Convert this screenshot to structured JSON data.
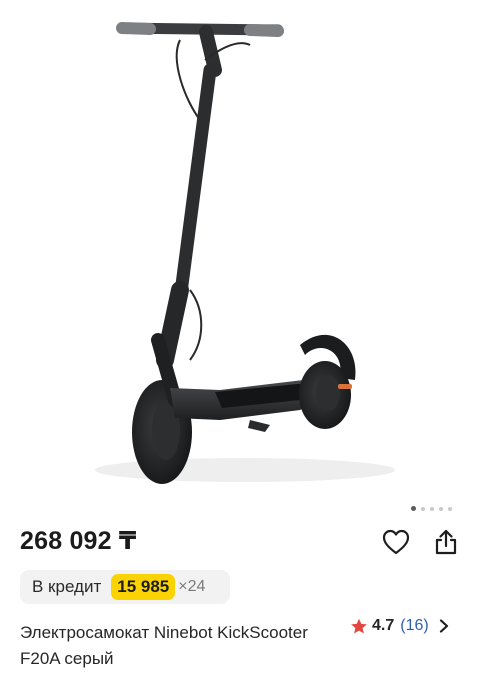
{
  "product": {
    "price": "268 092 ₸",
    "title": "Электросамокат Ninebot KickScooter F20A серый",
    "image_name": "scooter-photo"
  },
  "credit": {
    "label": "В кредит",
    "amount": "15 985",
    "multiplier": "×24"
  },
  "rating": {
    "value": "4.7",
    "count": "(16)",
    "star_color": "#e2483f"
  },
  "gallery": {
    "total_images": 5,
    "active_index": 0
  },
  "colors": {
    "credit_highlight": "#fbd301",
    "link": "#2f5fae"
  }
}
